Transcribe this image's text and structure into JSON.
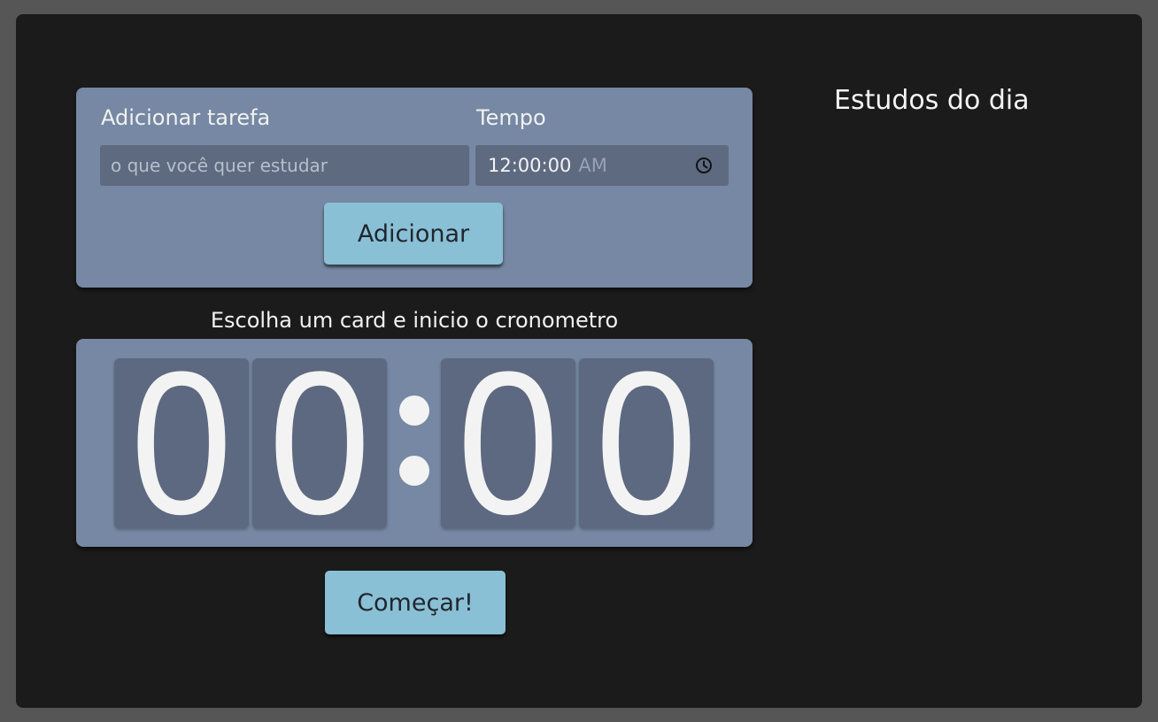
{
  "form": {
    "task_label": "Adicionar tarefa",
    "task_placeholder": "o que você quer estudar",
    "task_value": "",
    "time_label": "Tempo",
    "time_value": "12:00:00",
    "time_ampm": "AM",
    "time_icon": "clock-icon",
    "add_button": "Adicionar"
  },
  "timer": {
    "instructions": "Escolha um card e inicio o cronometro",
    "digits": [
      "0",
      "0",
      "0",
      "0"
    ],
    "separator_icon": "colon-separator",
    "start_button": "Começar!"
  },
  "sidebar": {
    "title": "Estudos do dia"
  },
  "colors": {
    "page_background": "#565656",
    "app_background": "#1b1b1b",
    "panel": "#7688a3",
    "input": "#5e6a80",
    "digit_card": "#5d6980",
    "button": "#8ac0d6",
    "text_light": "#f1f1f1"
  }
}
